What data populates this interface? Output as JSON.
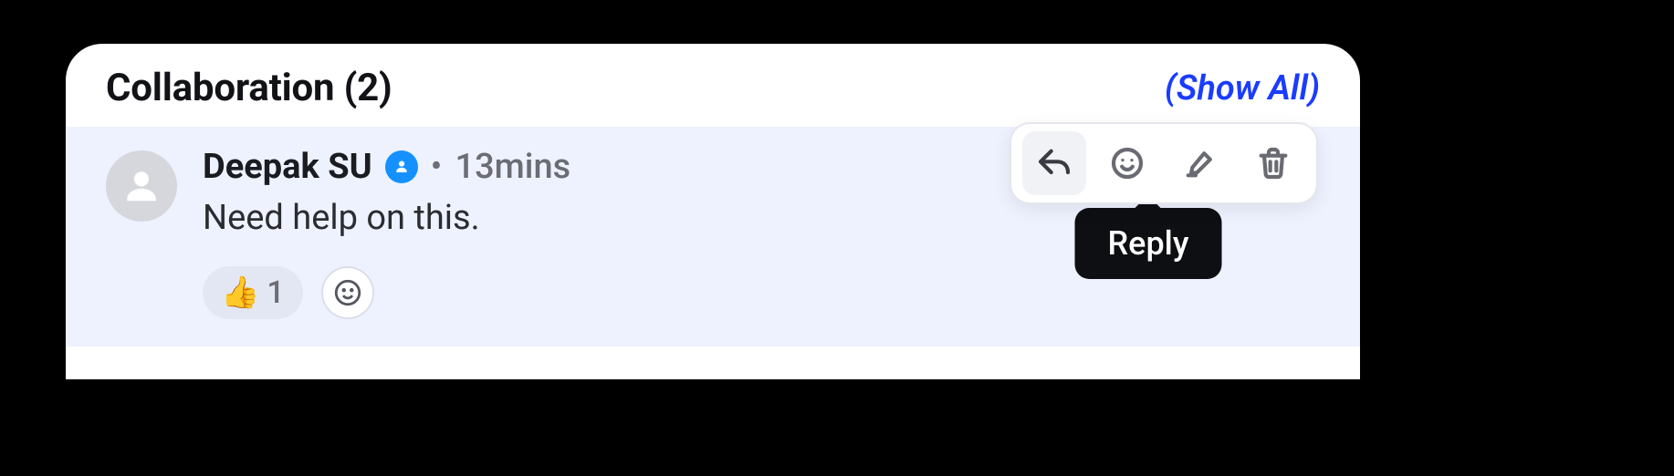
{
  "header": {
    "title": "Collaboration (2)",
    "show_all": "(Show All)"
  },
  "comment": {
    "author": "Deepak SU",
    "meta_dot": "•",
    "time": "13mins",
    "text": "Need help on this.",
    "reactions": [
      {
        "emoji": "👍",
        "count": "1"
      }
    ]
  },
  "toolbar": {
    "tooltip_reply": "Reply"
  }
}
